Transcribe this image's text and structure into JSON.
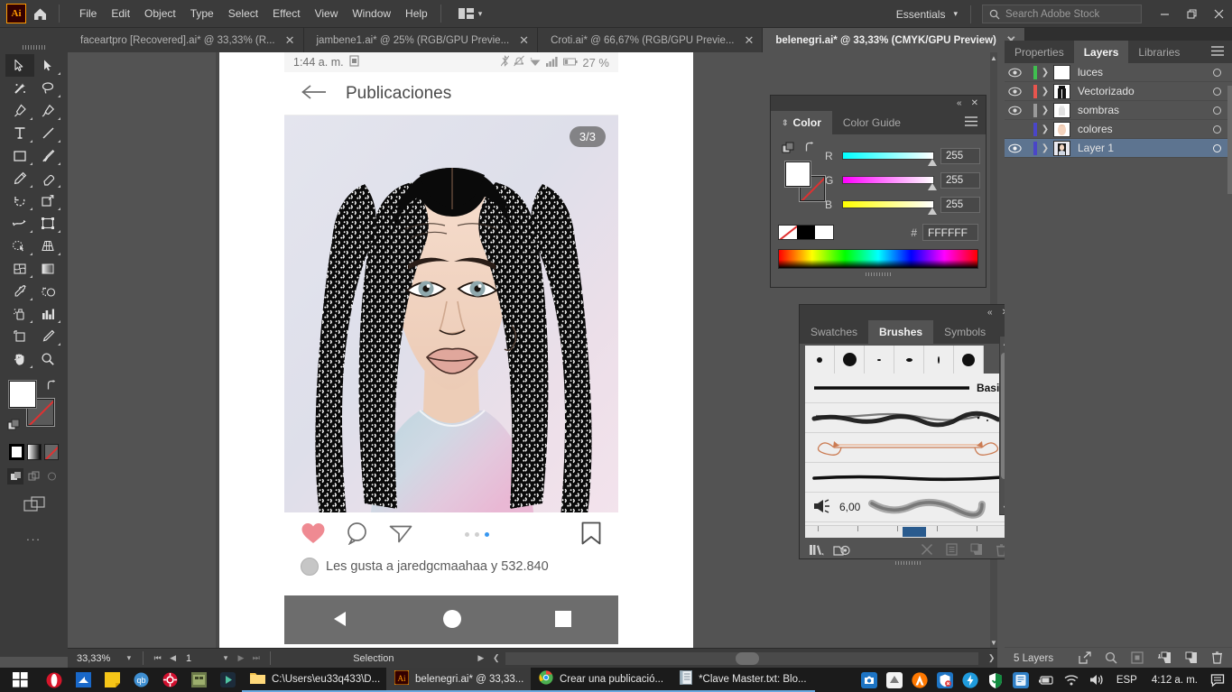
{
  "app": {
    "name": "Adobe Illustrator",
    "logo_text": "Ai"
  },
  "menubar": {
    "items": [
      "File",
      "Edit",
      "Object",
      "Type",
      "Select",
      "Effect",
      "View",
      "Window",
      "Help"
    ],
    "workspace": "Essentials",
    "search_placeholder": "Search Adobe Stock"
  },
  "tabs": [
    {
      "label": "faceartpro [Recovered].ai* @ 33,33% (R...",
      "active": false
    },
    {
      "label": "jambene1.ai* @ 25% (RGB/GPU Previe...",
      "active": false
    },
    {
      "label": "Croti.ai* @ 66,67% (RGB/GPU Previe...",
      "active": false
    },
    {
      "label": "belenegri.ai* @ 33,33% (CMYK/GPU Preview)",
      "active": true
    }
  ],
  "toolbar": {
    "tools": [
      {
        "name": "selection-tool",
        "active": true
      },
      {
        "name": "direct-selection-tool",
        "active": false
      },
      {
        "name": "magic-wand-tool",
        "active": false
      },
      {
        "name": "lasso-tool",
        "active": false
      },
      {
        "name": "pen-tool",
        "active": false
      },
      {
        "name": "curvature-tool",
        "active": false
      },
      {
        "name": "type-tool",
        "active": false
      },
      {
        "name": "line-segment-tool",
        "active": false
      },
      {
        "name": "rectangle-tool",
        "active": false
      },
      {
        "name": "paintbrush-tool",
        "active": false
      },
      {
        "name": "pencil-tool",
        "active": false
      },
      {
        "name": "eraser-tool",
        "active": false
      },
      {
        "name": "rotate-tool",
        "active": false
      },
      {
        "name": "scale-tool",
        "active": false
      },
      {
        "name": "width-tool",
        "active": false
      },
      {
        "name": "free-transform-tool",
        "active": false
      },
      {
        "name": "shape-builder-tool",
        "active": false
      },
      {
        "name": "perspective-grid-tool",
        "active": false
      },
      {
        "name": "mesh-tool",
        "active": false
      },
      {
        "name": "gradient-tool",
        "active": false
      },
      {
        "name": "eyedropper-tool",
        "active": false
      },
      {
        "name": "blend-tool",
        "active": false
      },
      {
        "name": "symbol-sprayer-tool",
        "active": false
      },
      {
        "name": "column-graph-tool",
        "active": false
      },
      {
        "name": "artboard-tool",
        "active": false
      },
      {
        "name": "slice-tool",
        "active": false
      },
      {
        "name": "hand-tool",
        "active": false
      },
      {
        "name": "zoom-tool",
        "active": false
      }
    ],
    "fill_color": "#FFFFFF",
    "stroke_color": "none",
    "more_label": "..."
  },
  "canvas": {
    "phone": {
      "status_time": "1:44 a. m.",
      "battery": "27 %",
      "screen_title": "Publicaciones",
      "image_counter": "3/3",
      "likes_text": "Les gusta a jaredgcmaahaa y 532.840",
      "carousel_dots": 3,
      "carousel_active_index": 2,
      "actions": [
        "like-icon",
        "comment-icon",
        "share-icon",
        "bookmark-icon"
      ]
    }
  },
  "color_panel": {
    "tabs": [
      {
        "label": "Color",
        "active": true
      },
      {
        "label": "Color Guide",
        "active": false
      }
    ],
    "channels": [
      {
        "label": "R",
        "value": "255"
      },
      {
        "label": "G",
        "value": "255"
      },
      {
        "label": "B",
        "value": "255"
      }
    ],
    "hex_symbol": "#",
    "hex_value": "FFFFFF"
  },
  "brushes_panel": {
    "tabs": [
      {
        "label": "Swatches",
        "active": false
      },
      {
        "label": "Brushes",
        "active": true
      },
      {
        "label": "Symbols",
        "active": false
      }
    ],
    "brush_rows": [
      {
        "name": "Basic",
        "type": "calligraphic-stroke"
      },
      {
        "name": "",
        "type": "charcoal-stroke"
      },
      {
        "name": "",
        "type": "arrow-art-brush"
      },
      {
        "name": "",
        "type": "tapered-stroke"
      },
      {
        "name": "",
        "type": "bristle-stroke"
      }
    ],
    "size_value": "6,00",
    "footer_icons": [
      "brush-libraries-icon",
      "libraries-icon",
      "remove-brush-stroke-icon",
      "options-icon",
      "new-brush-icon",
      "delete-brush-icon"
    ]
  },
  "right_dock": {
    "tabs": [
      {
        "label": "Properties",
        "active": false
      },
      {
        "label": "Layers",
        "active": true
      },
      {
        "label": "Libraries",
        "active": false
      }
    ],
    "layers": [
      {
        "name": "luces",
        "visible": true,
        "color": "#3fbf4f",
        "selected": false,
        "thumb": "blank-white"
      },
      {
        "name": "Vectorizado",
        "visible": true,
        "color": "#e8554e",
        "selected": false,
        "thumb": "black-figure"
      },
      {
        "name": "sombras",
        "visible": true,
        "color": "#9a9a9a",
        "selected": false,
        "thumb": "faint-figure"
      },
      {
        "name": "colores",
        "visible": false,
        "color": "#4a46c8",
        "selected": false,
        "thumb": "skin-face"
      },
      {
        "name": "Layer 1",
        "visible": true,
        "color": "#4a46c8",
        "selected": true,
        "thumb": "full-art"
      }
    ],
    "footer_count": "5 Layers",
    "footer_icons": [
      "release-to-layers-icon",
      "locate-object-icon",
      "make-clipping-mask-icon",
      "create-new-sublayer-icon",
      "create-new-layer-icon",
      "delete-selection-icon"
    ]
  },
  "statusbar": {
    "zoom": "33,33%",
    "page": "1",
    "tool_status": "Selection"
  },
  "taskbar": {
    "pinned": [
      {
        "name": "start-button"
      },
      {
        "name": "opera-icon"
      },
      {
        "name": "sumatra-icon"
      },
      {
        "name": "sticky-notes-icon"
      },
      {
        "name": "qbittorrent-icon"
      },
      {
        "name": "settings-icon"
      },
      {
        "name": "app-icon"
      },
      {
        "name": "media-player-icon"
      }
    ],
    "tasks": [
      {
        "label": "C:\\Users\\eu33q433\\D...",
        "icon": "folder-icon",
        "active": false
      },
      {
        "label": "belenegri.ai* @ 33,33...",
        "icon": "illustrator-icon",
        "active": true
      },
      {
        "label": "Crear una publicació...",
        "icon": "chrome-icon",
        "active": false
      },
      {
        "label": "*Clave Master.txt: Blo...",
        "icon": "notepad-icon",
        "active": false
      }
    ],
    "tray_icons": [
      "camera-icon",
      "drive-icon",
      "avast-icon",
      "security-icon",
      "driver-icon",
      "shield-icon",
      "bluestacks-icon",
      "battery-icon",
      "wifi-icon",
      "volume-icon"
    ],
    "language": "ESP",
    "clock": "4:12 a. m.",
    "notification": "notification-icon"
  },
  "colors": {
    "accent": "#6aa9e0",
    "panel_bg": "#535353",
    "chrome_bg": "#3b3b3b",
    "selected_layer": "#5d7490",
    "ai_orange": "#ff9a00"
  }
}
